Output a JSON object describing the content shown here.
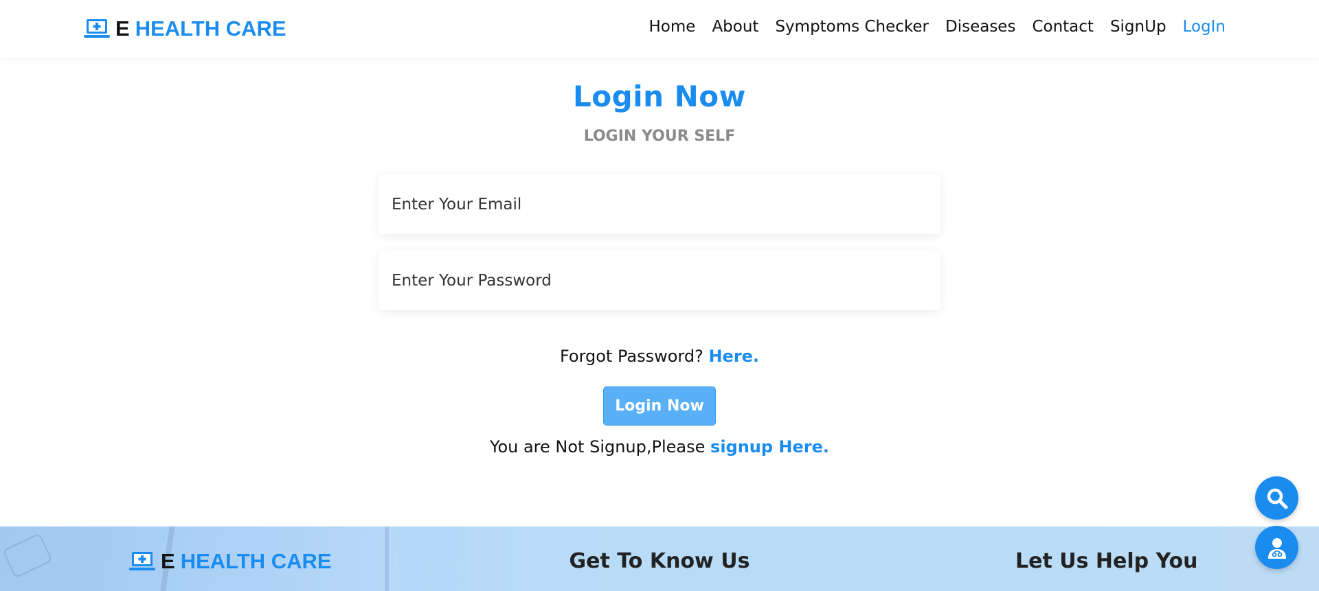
{
  "brand": {
    "prefix": "E",
    "name": "HEALTH CARE",
    "accent": "#1a8cf0"
  },
  "nav": [
    {
      "label": "Home"
    },
    {
      "label": "About"
    },
    {
      "label": "Symptoms Checker"
    },
    {
      "label": "Diseases"
    },
    {
      "label": "Contact"
    },
    {
      "label": "SignUp"
    },
    {
      "label": "LogIn",
      "active": true
    }
  ],
  "login": {
    "title": "Login Now",
    "subtitle": "LOGIN YOUR SELF",
    "email_placeholder": "Enter Your Email",
    "password_placeholder": "Enter Your Password",
    "forgot_text": "Forgot Password?",
    "forgot_link": "Here.",
    "submit_label": "Login Now",
    "signup_text": "You are Not Signup,Please",
    "signup_link": "signup Here."
  },
  "footer": {
    "col1_prefix": "E",
    "col1_name": "HEALTH CARE",
    "col2_heading": "Get To Know Us",
    "col3_heading": "Let Us Help You"
  },
  "fabs": {
    "search": "search-icon",
    "doctor": "doctor-icon"
  }
}
